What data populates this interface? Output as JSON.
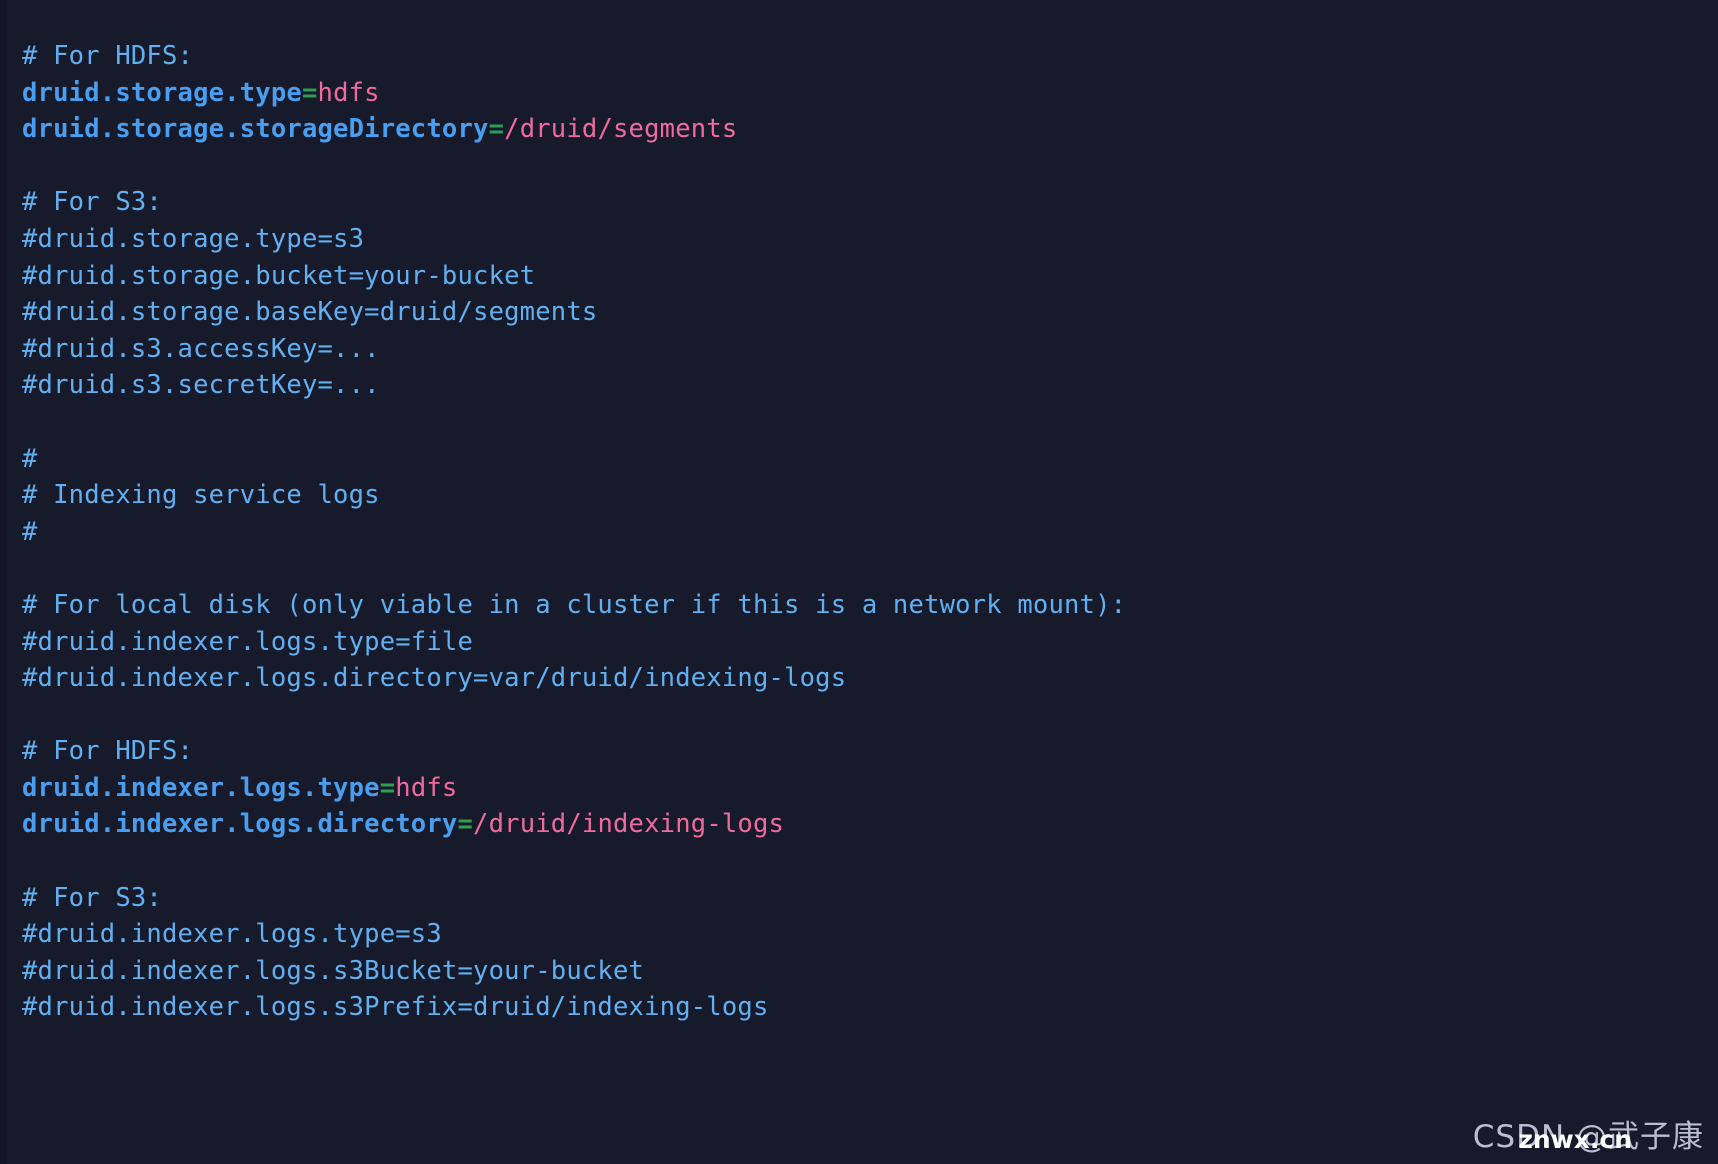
{
  "document": {
    "kind": "code-snippet",
    "language": "properties",
    "theme": {
      "background": "#161a2b",
      "gutter": "#121624",
      "comment": "#62b0f2",
      "key": "#4a9eef",
      "equals": "#2f9e52",
      "value": "#ef6b9e",
      "watermark": "#b9bfd0"
    },
    "lines": [
      {
        "type": "comment",
        "text": "# For HDFS:"
      },
      {
        "type": "property",
        "key": "druid.storage.type",
        "eq": "=",
        "value": "hdfs"
      },
      {
        "type": "property",
        "key": "druid.storage.storageDirectory",
        "eq": "=",
        "value": "/druid/segments"
      },
      {
        "type": "blank",
        "text": ""
      },
      {
        "type": "comment",
        "text": "# For S3:"
      },
      {
        "type": "comment",
        "text": "#druid.storage.type=s3"
      },
      {
        "type": "comment",
        "text": "#druid.storage.bucket=your-bucket"
      },
      {
        "type": "comment",
        "text": "#druid.storage.baseKey=druid/segments"
      },
      {
        "type": "comment",
        "text": "#druid.s3.accessKey=..."
      },
      {
        "type": "comment",
        "text": "#druid.s3.secretKey=..."
      },
      {
        "type": "blank",
        "text": ""
      },
      {
        "type": "comment",
        "text": "#"
      },
      {
        "type": "comment",
        "text": "# Indexing service logs"
      },
      {
        "type": "comment",
        "text": "#"
      },
      {
        "type": "blank",
        "text": ""
      },
      {
        "type": "comment",
        "text": "# For local disk (only viable in a cluster if this is a network mount):"
      },
      {
        "type": "comment",
        "text": "#druid.indexer.logs.type=file"
      },
      {
        "type": "comment",
        "text": "#druid.indexer.logs.directory=var/druid/indexing-logs"
      },
      {
        "type": "blank",
        "text": ""
      },
      {
        "type": "comment",
        "text": "# For HDFS:"
      },
      {
        "type": "property",
        "key": "druid.indexer.logs.type",
        "eq": "=",
        "value": "hdfs"
      },
      {
        "type": "property",
        "key": "druid.indexer.logs.directory",
        "eq": "=",
        "value": "/druid/indexing-logs"
      },
      {
        "type": "blank",
        "text": ""
      },
      {
        "type": "comment",
        "text": "# For S3:"
      },
      {
        "type": "comment",
        "text": "#druid.indexer.logs.type=s3"
      },
      {
        "type": "comment",
        "text": "#druid.indexer.logs.s3Bucket=your-bucket"
      },
      {
        "type": "comment",
        "text": "#druid.indexer.logs.s3Prefix=druid/indexing-logs"
      }
    ]
  },
  "watermark": {
    "csdn_text": "CSDN @武子康",
    "overlay_text": "znwx.cn"
  }
}
